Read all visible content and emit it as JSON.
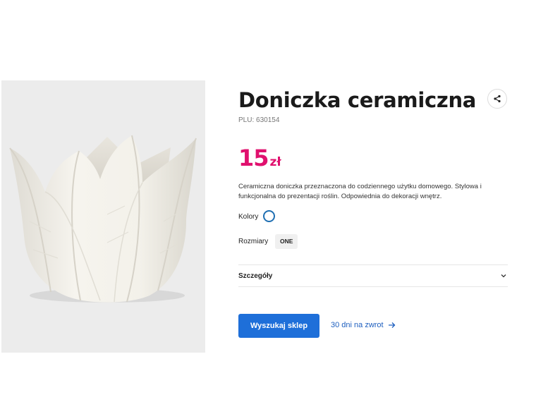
{
  "product": {
    "title": "Doniczka ceramiczna",
    "plu": "PLU: 630154",
    "price_amount": "15",
    "price_currency": "zł",
    "description": "Ceramiczna doniczka przeznaczona do codziennego użytku domowego. Stylowa i funkcjonalna do prezentacji roślin. Odpowiednia do dekoracji wnętrz.",
    "image_icon": "ceramic-tulip-pot"
  },
  "options": {
    "colors_label": "Kolory",
    "sizes_label": "Rozmiary",
    "size_selected": "ONE"
  },
  "details": {
    "label": "Szczegóły"
  },
  "actions": {
    "find_store_label": "Wyszukaj sklep",
    "return_link_label": "30 dni na zwrot"
  },
  "colors": {
    "price": "#e0106e",
    "primary_button": "#1e6fd9",
    "link": "#1e5fbf",
    "swatch_ring": "#1f6fb2"
  },
  "icons": {
    "share": "share-icon",
    "chevron": "chevron-down-icon",
    "arrow": "arrow-right-icon"
  }
}
